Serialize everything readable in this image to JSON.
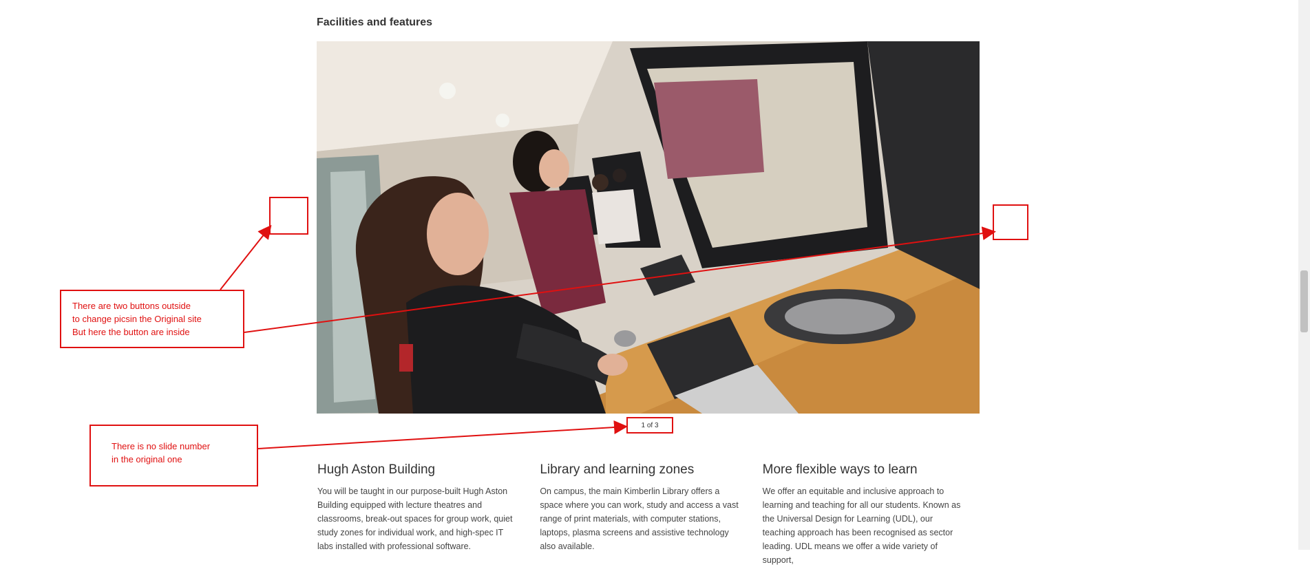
{
  "section": {
    "title": "Facilities and features"
  },
  "slider": {
    "counter": "1 of 3",
    "current_slide": 1,
    "total_slides": 3,
    "image_subject": "students at computer workstations"
  },
  "annotations": [
    {
      "lines": [
        "There are two buttons outside",
        "to change picsin the Original site",
        "But here the button are inside"
      ]
    },
    {
      "lines": [
        "There is no slide number",
        "in the original one"
      ]
    }
  ],
  "columns": [
    {
      "heading": "Hugh Aston Building",
      "body": "You will be taught in our purpose-built Hugh Aston Building equipped with lecture theatres and classrooms, break-out spaces for group work, quiet study zones for individual work, and high-spec IT labs installed with professional software."
    },
    {
      "heading": "Library and learning zones",
      "body": "On campus, the main Kimberlin Library offers a space where you can work, study and access a vast range of print materials, with computer stations, laptops, plasma screens and assistive technology also available."
    },
    {
      "heading": "More flexible ways to learn",
      "body": "We offer an equitable and inclusive approach to learning and teaching for all our students. Known as the Universal Design for Learning (UDL), our teaching approach has been recognised as sector leading. UDL means we offer a wide variety of support,"
    }
  ],
  "colors": {
    "annotation": "#e01010",
    "text": "#333333"
  }
}
